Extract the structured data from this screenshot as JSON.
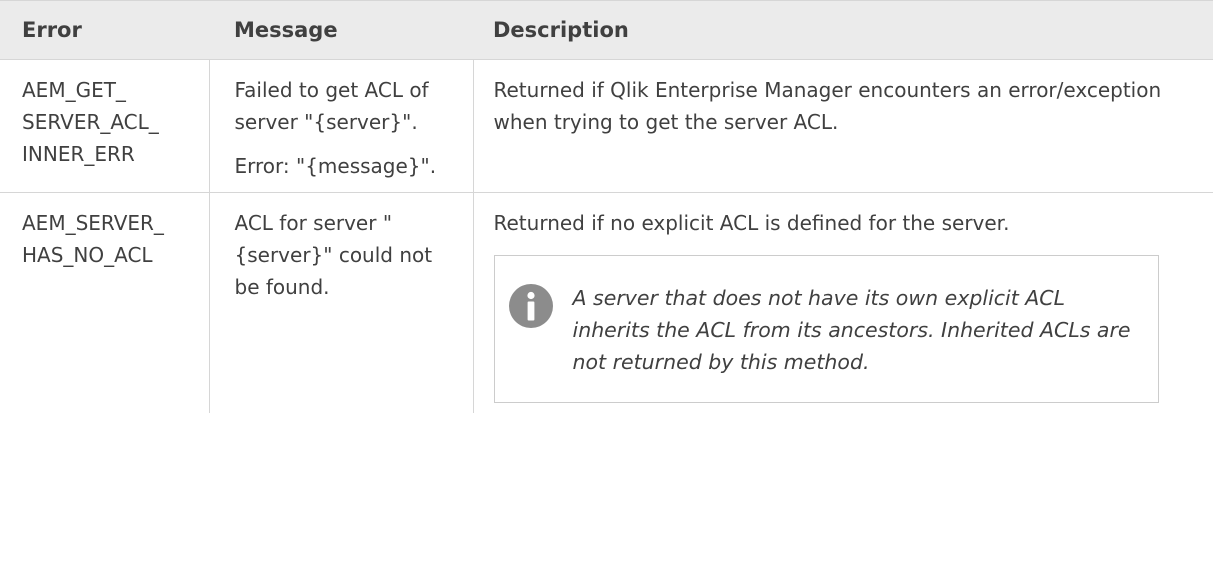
{
  "table": {
    "headers": {
      "error": "Error",
      "message": "Message",
      "description": "Description"
    },
    "rows": [
      {
        "error_lines": [
          "AEM_GET_",
          "SERVER_ACL_",
          "INNER_ERR"
        ],
        "message_paragraphs": [
          "Failed to get ACL of server \"{server}\".",
          "Error: \"{message}\"."
        ],
        "description": "Returned if Qlik Enterprise Manager encounters an error/exception when trying to get the server ACL."
      },
      {
        "error_lines": [
          "AEM_SERVER_",
          "HAS_NO_ACL"
        ],
        "message_paragraphs": [
          "ACL for server \"{server}\" could not be found."
        ],
        "description": "Returned if no explicit ACL is defined for the server.",
        "note": {
          "icon": "info-icon",
          "text": "A server that does not have its own explicit ACL inherits the ACL from its ancestors. Inherited ACLs are not returned by this method."
        }
      }
    ]
  },
  "colors": {
    "header_bg": "#ebebeb",
    "border": "#d6d6d6",
    "text": "#404040",
    "icon": "#8c8c8c"
  }
}
